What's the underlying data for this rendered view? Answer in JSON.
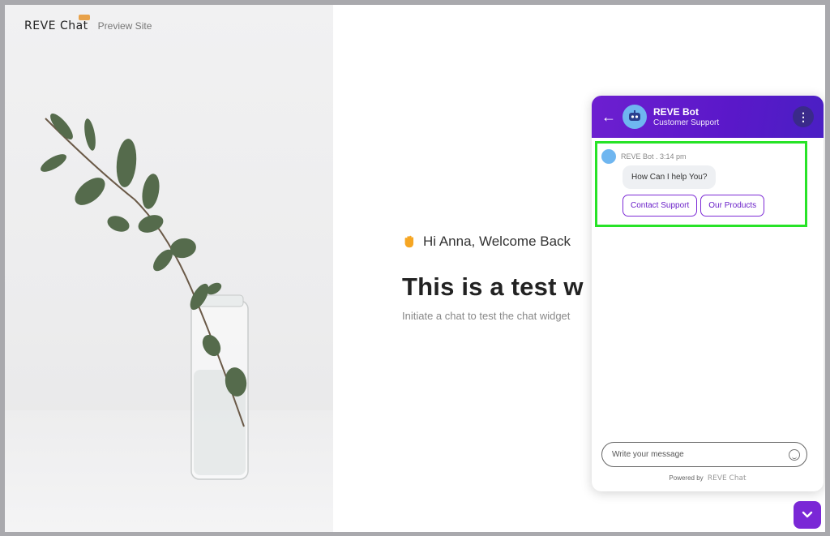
{
  "site": {
    "brand": "REVE Chat",
    "label": "Preview Site"
  },
  "welcome": {
    "greeting": "Hi Anna, Welcome Back",
    "headline": "This is a test w",
    "subline": "Initiate a chat to test the chat widget"
  },
  "chat": {
    "header": {
      "bot_name": "REVE Bot",
      "bot_role": "Customer Support"
    },
    "message": {
      "meta": "REVE Bot . 3:14 pm",
      "text": "How Can I help You?"
    },
    "quick_replies": [
      "Contact Support",
      "Our Products"
    ],
    "composer": {
      "placeholder": "Write your message"
    },
    "footer": {
      "powered_by": "Powered by",
      "brand": "REVE Chat"
    }
  },
  "colors": {
    "accent": "#6d1fd0",
    "highlight": "#27e327"
  }
}
